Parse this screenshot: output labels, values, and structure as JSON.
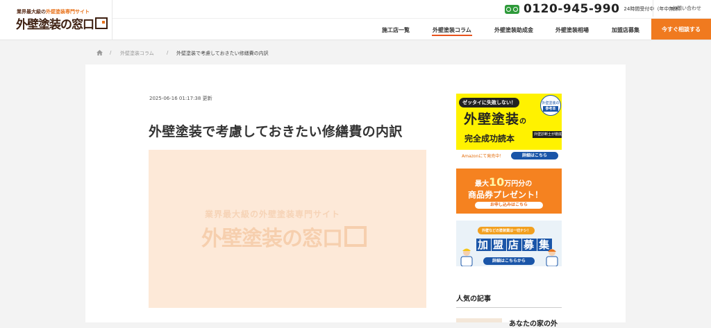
{
  "header": {
    "logo_tag_prefix": "業界最大級の",
    "logo_tag_highlight": "外壁塗装専門サイト",
    "logo_main": "外壁塗装の窓口",
    "phone_number": "0120-945-990",
    "phone_hours": "24時間受付中（年中無休）",
    "contact_label": "お問い合わせ",
    "nav": [
      {
        "label": "施工店一覧"
      },
      {
        "label": "外壁塗装コラム"
      },
      {
        "label": "外壁塗装助成金"
      },
      {
        "label": "外壁塗装相場"
      },
      {
        "label": "加盟店募集"
      }
    ],
    "cta_label": "今すぐ相談する",
    "accent_color": "#f07a1f"
  },
  "breadcrumb": {
    "sep": "/",
    "items": [
      "外壁塗装コラム",
      "外壁塗装で考慮しておきたい修繕費の内訳"
    ]
  },
  "article": {
    "updated": "2025-06-16 01:17:38 更新",
    "title": "外壁塗装で考慮しておきたい修繕費の内訳",
    "hero_sub": "業界最大級の外壁塗装専門サイト",
    "hero_main": "外壁塗装の窓口"
  },
  "sidebar": {
    "banner1": {
      "pill": "ゼッタイに失敗しない！",
      "circle_top": "外壁塗装の",
      "circle_bottom": "参考本",
      "main": "外壁塗装",
      "main_suffix": "の",
      "sub": "完全成功読本",
      "tag": "外壁診断士が徹底解説！",
      "amazon": "Amazonにて発売中！",
      "button": "詳細はこちら"
    },
    "banner2": {
      "line1_prefix": "最大",
      "line1_big": "10",
      "line1_suffix": "万円分の",
      "line2": "商品券プレゼント！",
      "button": "お申し込みはこちら"
    },
    "banner3": {
      "top": "外壁などの塗装業は一切ナシ！",
      "chars": [
        "加",
        "盟",
        "店",
        "募",
        "集"
      ],
      "button": "詳細はこちらから"
    },
    "popular_heading": "人気の記事",
    "popular_first_title": "あなたの家の外"
  }
}
